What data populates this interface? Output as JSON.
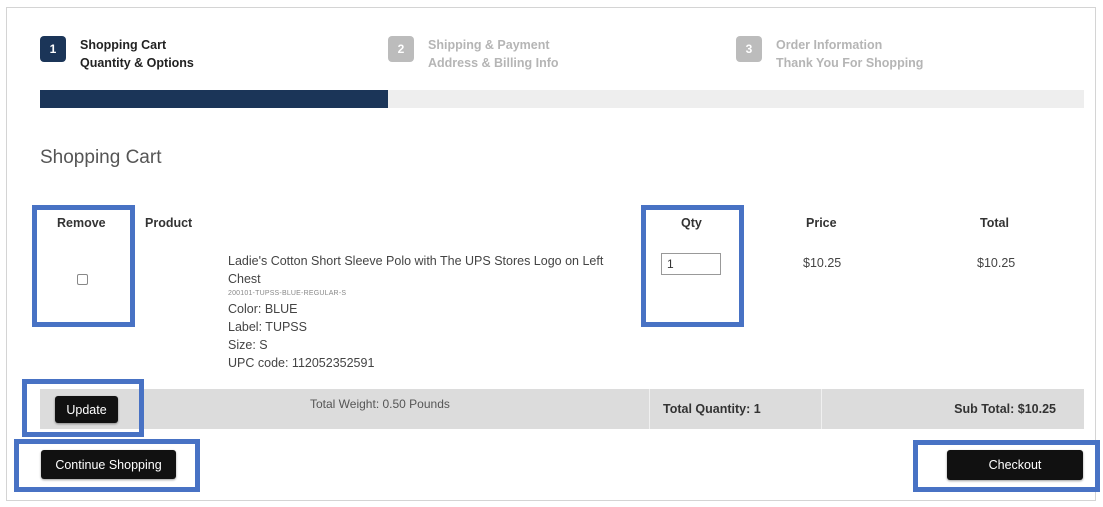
{
  "steps": [
    {
      "number": "1",
      "title": "Shopping Cart",
      "subtitle": "Quantity & Options"
    },
    {
      "number": "2",
      "title": "Shipping & Payment",
      "subtitle": "Address & Billing Info"
    },
    {
      "number": "3",
      "title": "Order Information",
      "subtitle": "Thank You For Shopping"
    }
  ],
  "progress": {
    "fraction": 0.333
  },
  "cart": {
    "title": "Shopping Cart",
    "headers": {
      "remove": "Remove",
      "product": "Product",
      "qty": "Qty",
      "price": "Price",
      "total": "Total"
    },
    "item": {
      "name": "Ladie's Cotton Short Sleeve Polo with The UPS Stores Logo on Left Chest",
      "sku": "200101-TUPSS-BLUE-REGULAR-S",
      "color": "Color: BLUE",
      "label": "Label: TUPSS",
      "size": "Size: S",
      "upc": "UPC code: 112052352591",
      "qty": "1",
      "price": "$10.25",
      "total": "$10.25",
      "remove_checked": false
    },
    "summary": {
      "weight": "Total Weight: 0.50 Pounds",
      "total_quantity": "Total Quantity: 1",
      "sub_total": "Sub Total: $10.25"
    },
    "buttons": {
      "update": "Update",
      "continue": "Continue Shopping",
      "checkout": "Checkout"
    }
  },
  "colors": {
    "accent": "#1b3558",
    "highlight": "#4872c4",
    "summary_bg": "#dcdcdc",
    "button": "#111111"
  }
}
